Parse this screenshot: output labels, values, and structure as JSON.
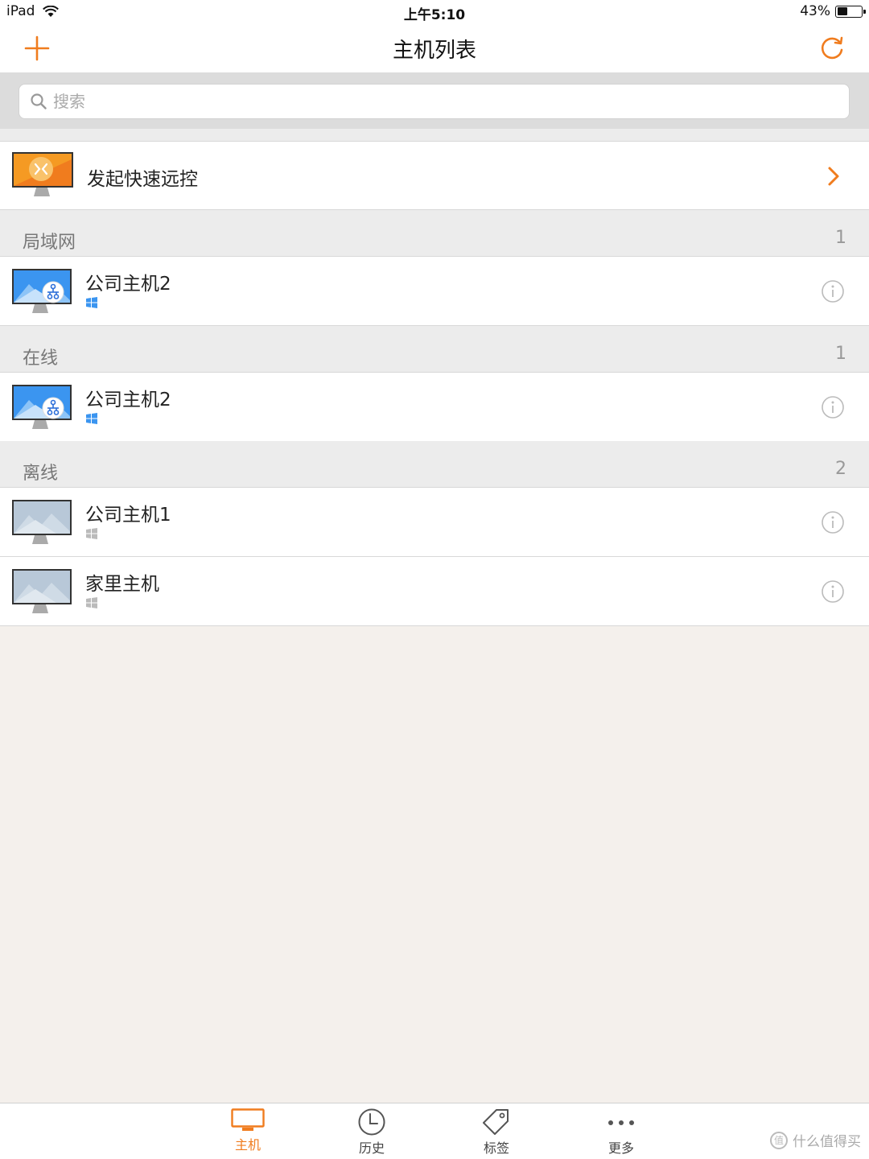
{
  "status_bar": {
    "device": "iPad",
    "time": "上午5:10",
    "battery": "43%",
    "battery_level": 0.43
  },
  "nav": {
    "title": "主机列表",
    "add_icon": "plus-icon",
    "refresh_icon": "refresh-icon"
  },
  "search": {
    "placeholder": "搜索",
    "value": ""
  },
  "quick_remote": {
    "label": "发起快速远控"
  },
  "sections": [
    {
      "title": "局域网",
      "count": "1",
      "hosts": [
        {
          "name": "公司主机2",
          "status": "online",
          "os": "windows",
          "lan": true
        }
      ]
    },
    {
      "title": "在线",
      "count": "1",
      "hosts": [
        {
          "name": "公司主机2",
          "status": "online",
          "os": "windows",
          "lan": true
        }
      ]
    },
    {
      "title": "离线",
      "count": "2",
      "hosts": [
        {
          "name": "公司主机1",
          "status": "offline",
          "os": "windows",
          "lan": false
        },
        {
          "name": "家里主机",
          "status": "offline",
          "os": "windows",
          "lan": false
        }
      ]
    }
  ],
  "tabs": [
    {
      "label": "主机",
      "icon": "monitor-icon",
      "active": true
    },
    {
      "label": "历史",
      "icon": "clock-icon",
      "active": false
    },
    {
      "label": "标签",
      "icon": "tag-icon",
      "active": false
    },
    {
      "label": "更多",
      "icon": "more-dots-icon",
      "active": false
    }
  ],
  "watermark": "什么值得买",
  "colors": {
    "accent": "#f07c1e",
    "online_screen": "#3b95f0",
    "offline_screen": "#b8c8d8",
    "section_bg": "#ececec",
    "empty_bg": "#f4f0ec"
  }
}
